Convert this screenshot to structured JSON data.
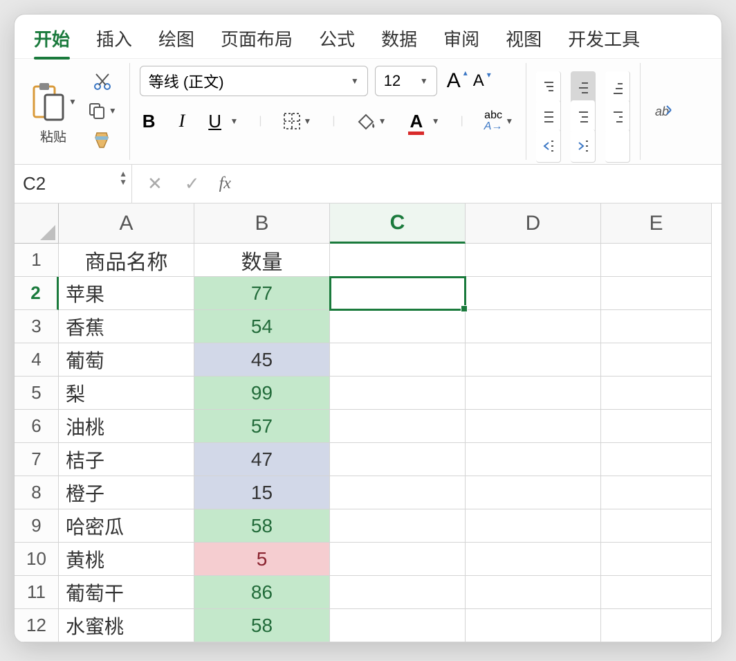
{
  "tabs": [
    "开始",
    "插入",
    "绘图",
    "页面布局",
    "公式",
    "数据",
    "审阅",
    "视图",
    "开发工具"
  ],
  "active_tab_index": 0,
  "ribbon": {
    "paste_label": "粘贴",
    "font_name": "等线 (正文)",
    "font_size": "12"
  },
  "namebox": "C2",
  "formula": "",
  "fx_label": "fx",
  "columns": [
    "A",
    "B",
    "C",
    "D",
    "E"
  ],
  "selected_cell": {
    "row": 2,
    "col": "C"
  },
  "headers": {
    "A": "商品名称",
    "B": "数量"
  },
  "rows": [
    {
      "n": 1,
      "A": "商品名称",
      "B": "数量",
      "style": "header"
    },
    {
      "n": 2,
      "A": "苹果",
      "B": "77",
      "style": "green"
    },
    {
      "n": 3,
      "A": "香蕉",
      "B": "54",
      "style": "green"
    },
    {
      "n": 4,
      "A": "葡萄",
      "B": "45",
      "style": "blue"
    },
    {
      "n": 5,
      "A": "梨",
      "B": "99",
      "style": "green"
    },
    {
      "n": 6,
      "A": "油桃",
      "B": "57",
      "style": "green"
    },
    {
      "n": 7,
      "A": "桔子",
      "B": "47",
      "style": "blue"
    },
    {
      "n": 8,
      "A": "橙子",
      "B": "15",
      "style": "blue"
    },
    {
      "n": 9,
      "A": "哈密瓜",
      "B": "58",
      "style": "green"
    },
    {
      "n": 10,
      "A": "黄桃",
      "B": "5",
      "style": "pink"
    },
    {
      "n": 11,
      "A": "葡萄干",
      "B": "86",
      "style": "green"
    },
    {
      "n": 12,
      "A": "水蜜桃",
      "B": "58",
      "style": "green"
    }
  ],
  "colors": {
    "green": "#c4e8cb",
    "blue": "#d2d8e8",
    "pink": "#f5cdd0",
    "accent": "#1a7a3c"
  }
}
